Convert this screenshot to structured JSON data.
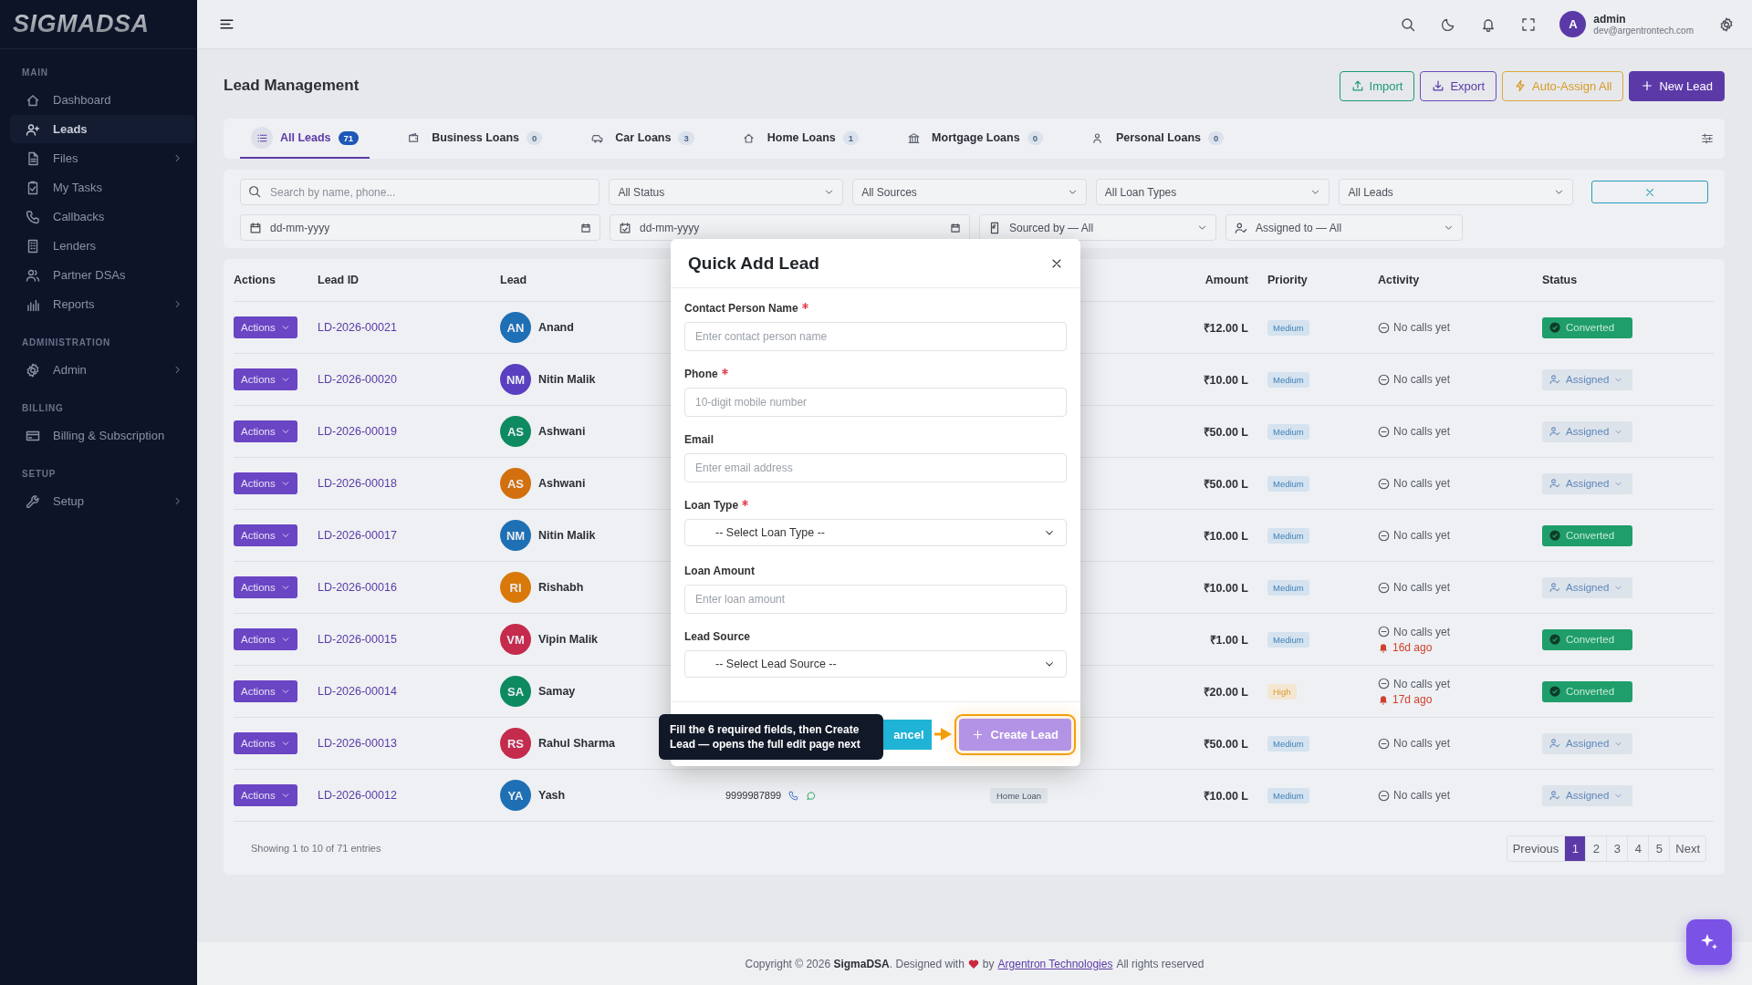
{
  "sidebar": {
    "logo": "SIGMADSA",
    "sections": [
      {
        "heading": "MAIN",
        "items": [
          {
            "label": "Dashboard",
            "selected": false,
            "expandable": false
          },
          {
            "label": "Leads",
            "selected": true,
            "expandable": false
          },
          {
            "label": "Files",
            "selected": false,
            "expandable": true
          },
          {
            "label": "My Tasks",
            "selected": false,
            "expandable": false
          },
          {
            "label": "Callbacks",
            "selected": false,
            "expandable": false
          },
          {
            "label": "Lenders",
            "selected": false,
            "expandable": false
          },
          {
            "label": "Partner DSAs",
            "selected": false,
            "expandable": false
          },
          {
            "label": "Reports",
            "selected": false,
            "expandable": true
          }
        ]
      },
      {
        "heading": "ADMINISTRATION",
        "items": [
          {
            "label": "Admin",
            "selected": false,
            "expandable": true
          }
        ]
      },
      {
        "heading": "BILLING",
        "items": [
          {
            "label": "Billing & Subscription",
            "selected": false,
            "expandable": false
          }
        ]
      },
      {
        "heading": "SETUP",
        "items": [
          {
            "label": "Setup",
            "selected": false,
            "expandable": true
          }
        ]
      }
    ]
  },
  "header": {
    "user": {
      "initial": "A",
      "name": "admin",
      "email": "dev@argentrontech.com"
    }
  },
  "page": {
    "title": "Lead Management",
    "buttons": [
      {
        "label": "Import",
        "kind": "import"
      },
      {
        "label": "Export",
        "kind": "export"
      },
      {
        "label": "Auto-Assign All",
        "kind": "auto"
      },
      {
        "label": "New Lead",
        "kind": "new"
      }
    ]
  },
  "tabs": [
    {
      "label": "All Leads",
      "count": "71",
      "selected": true
    },
    {
      "label": "Business Loans",
      "count": "0",
      "selected": false
    },
    {
      "label": "Car Loans",
      "count": "3",
      "selected": false
    },
    {
      "label": "Home Loans",
      "count": "1",
      "selected": false
    },
    {
      "label": "Mortgage Loans",
      "count": "0",
      "selected": false
    },
    {
      "label": "Personal Loans",
      "count": "0",
      "selected": false
    }
  ],
  "filters": {
    "search": {
      "placeholder": "Search by name, phone..."
    },
    "selects": [
      "All Status",
      "All Sources",
      "All Loan Types",
      "All Leads"
    ],
    "dates": [
      "dd-mm-yyyy",
      "dd-mm-yyyy"
    ],
    "people": [
      "Sourced by — All",
      "Assigned to — All"
    ]
  },
  "table": {
    "columns": [
      "Actions",
      "Lead ID",
      "Lead",
      "Amount",
      "Priority",
      "Activity",
      "Status"
    ],
    "rows": [
      {
        "action": "Actions",
        "id": "LD-2026-00021",
        "initials": "AN",
        "color": "#1f6fb5",
        "name": "Anand",
        "amount": "₹12.00 L",
        "priority": {
          "label": "Medium",
          "kind": "medium"
        },
        "activity": "No calls yet",
        "status": {
          "label": "Converted",
          "kind": "converted"
        }
      },
      {
        "action": "Actions",
        "id": "LD-2026-00020",
        "initials": "NM",
        "color": "#5a3fc0",
        "name": "Nitin Malik",
        "amount": "₹10.00 L",
        "priority": {
          "label": "Medium",
          "kind": "medium"
        },
        "activity": "No calls yet",
        "status": {
          "label": "Assigned",
          "kind": "assigned"
        }
      },
      {
        "action": "Actions",
        "id": "LD-2026-00019",
        "initials": "AS",
        "color": "#0e8a60",
        "name": "Ashwani",
        "amount": "₹50.00 L",
        "priority": {
          "label": "Medium",
          "kind": "medium"
        },
        "activity": "No calls yet",
        "status": {
          "label": "Assigned",
          "kind": "assigned"
        }
      },
      {
        "action": "Actions",
        "id": "LD-2026-00018",
        "initials": "AS",
        "color": "#d2700f",
        "name": "Ashwani",
        "amount": "₹50.00 L",
        "priority": {
          "label": "Medium",
          "kind": "medium"
        },
        "activity": "No calls yet",
        "status": {
          "label": "Assigned",
          "kind": "assigned"
        }
      },
      {
        "action": "Actions",
        "id": "LD-2026-00017",
        "initials": "NM",
        "color": "#1f6fb5",
        "name": "Nitin Malik",
        "amount": "₹10.00 L",
        "priority": {
          "label": "Medium",
          "kind": "medium"
        },
        "activity": "No calls yet",
        "status": {
          "label": "Converted",
          "kind": "converted"
        }
      },
      {
        "action": "Actions",
        "id": "LD-2026-00016",
        "initials": "RI",
        "color": "#d9790a",
        "name": "Rishabh",
        "amount": "₹10.00 L",
        "priority": {
          "label": "Medium",
          "kind": "medium"
        },
        "activity": "No calls yet",
        "status": {
          "label": "Assigned",
          "kind": "assigned"
        }
      },
      {
        "action": "Actions",
        "id": "LD-2026-00015",
        "initials": "VM",
        "color": "#c42b4c",
        "name": "Vipin Malik",
        "amount": "₹1.00 L",
        "priority": {
          "label": "Medium",
          "kind": "medium"
        },
        "activity": "No calls yet",
        "reminder": "16d ago",
        "status": {
          "label": "Converted",
          "kind": "converted"
        }
      },
      {
        "action": "Actions",
        "id": "LD-2026-00014",
        "initials": "SA",
        "color": "#0e8a60",
        "name": "Samay",
        "amount": "₹20.00 L",
        "priority": {
          "label": "High",
          "kind": "high"
        },
        "activity": "No calls yet",
        "reminder": "17d ago",
        "status": {
          "label": "Converted",
          "kind": "converted"
        }
      },
      {
        "action": "Actions",
        "id": "LD-2026-00013",
        "initials": "RS",
        "color": "#c42b4c",
        "name": "Rahul Sharma",
        "amount": "₹50.00 L",
        "priority": {
          "label": "Medium",
          "kind": "medium"
        },
        "activity": "No calls yet",
        "status": {
          "label": "Assigned",
          "kind": "assigned"
        }
      },
      {
        "action": "Actions",
        "id": "LD-2026-00012",
        "initials": "YA",
        "color": "#1f6fb5",
        "name": "Yash",
        "phone": "9999987899",
        "loan_type": "Home Loan",
        "amount": "₹10.00 L",
        "priority": {
          "label": "Medium",
          "kind": "medium"
        },
        "activity": "No calls yet",
        "status": {
          "label": "Assigned",
          "kind": "assigned"
        }
      }
    ]
  },
  "pagination": {
    "info": "Showing 1 to 10 of 71 entries",
    "pages": [
      {
        "label": "Previous",
        "selected": false
      },
      {
        "label": "1",
        "selected": true
      },
      {
        "label": "2",
        "selected": false
      },
      {
        "label": "3",
        "selected": false
      },
      {
        "label": "4",
        "selected": false
      },
      {
        "label": "5",
        "selected": false
      },
      {
        "label": "Next",
        "selected": false
      }
    ]
  },
  "modal": {
    "title": "Quick Add Lead",
    "fields": [
      {
        "label": "Contact Person Name",
        "required": true,
        "kind": "input",
        "placeholder": "Enter contact person name"
      },
      {
        "label": "Phone",
        "required": true,
        "kind": "input",
        "placeholder": "10-digit mobile number"
      },
      {
        "label": "Email",
        "required": false,
        "kind": "input",
        "placeholder": "Enter email address"
      },
      {
        "label": "Loan Type",
        "required": true,
        "kind": "select",
        "value": "-- Select Loan Type --"
      },
      {
        "label": "Loan Amount",
        "required": false,
        "kind": "input",
        "placeholder": "Enter loan amount"
      },
      {
        "label": "Lead Source",
        "required": false,
        "kind": "select",
        "value": "-- Select Lead Source --"
      }
    ],
    "cancel": "ancel",
    "submit": "Create Lead",
    "tooltip": "Fill the 6 required fields, then Create Lead — opens the full edit page next"
  },
  "footer": {
    "prefix": "Copyright © 2026 **SigmaDSA**. Designed with",
    "by": "by",
    "link": "Argentron Technologies",
    "suffix": "All rights reserved"
  }
}
